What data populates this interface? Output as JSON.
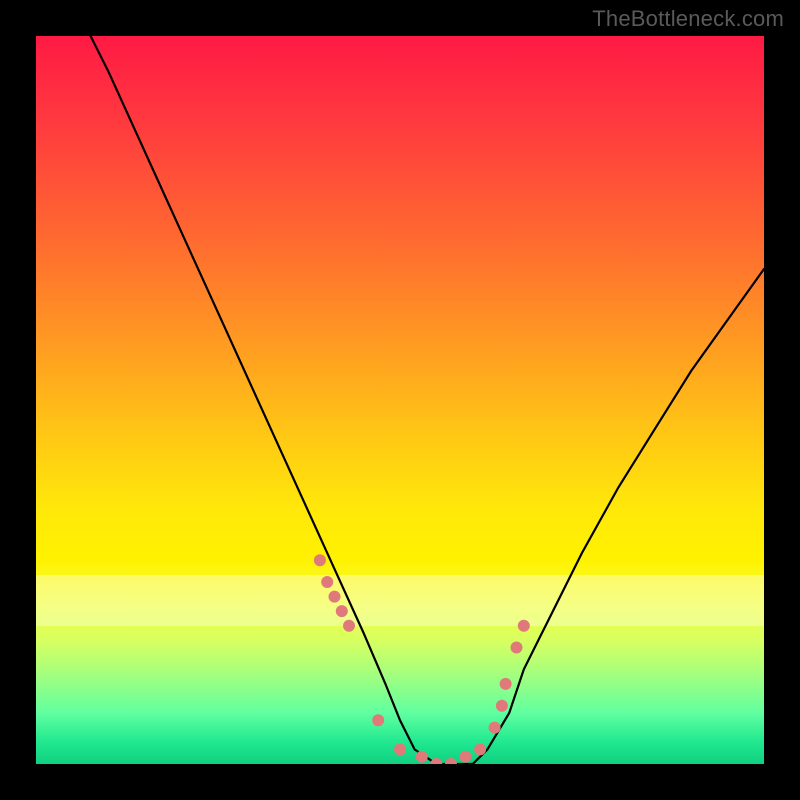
{
  "watermark": "TheBottleneck.com",
  "chart_data": {
    "type": "line",
    "title": "",
    "xlabel": "",
    "ylabel": "",
    "xlim": [
      0,
      100
    ],
    "ylim": [
      0,
      100
    ],
    "series": [
      {
        "name": "curve",
        "x": [
          0,
          5,
          10,
          15,
          20,
          25,
          30,
          35,
          40,
          45,
          48,
          50,
          52,
          55,
          57,
          60,
          62,
          65,
          67,
          70,
          75,
          80,
          85,
          90,
          95,
          100
        ],
        "values": [
          115,
          105,
          95,
          84,
          73,
          62,
          51,
          40,
          29,
          18,
          11,
          6,
          2,
          0,
          0,
          0,
          2,
          7,
          13,
          19,
          29,
          38,
          46,
          54,
          61,
          68
        ]
      }
    ],
    "highlight_points": {
      "name": "dots",
      "color": "#e07a7a",
      "x": [
        39,
        40,
        41,
        42,
        43,
        47,
        50,
        53,
        55,
        57,
        59,
        61,
        63,
        64,
        64.5,
        66,
        67
      ],
      "values": [
        28,
        25,
        23,
        21,
        19,
        6,
        2,
        1,
        0,
        0,
        1,
        2,
        5,
        8,
        11,
        16,
        19
      ]
    },
    "pale_band_y": [
      19,
      26
    ],
    "gradient_scale": {
      "top_color": "#ff1a44",
      "bottom_color": "#10d080",
      "meaning": "top=bad, bottom=good"
    }
  }
}
